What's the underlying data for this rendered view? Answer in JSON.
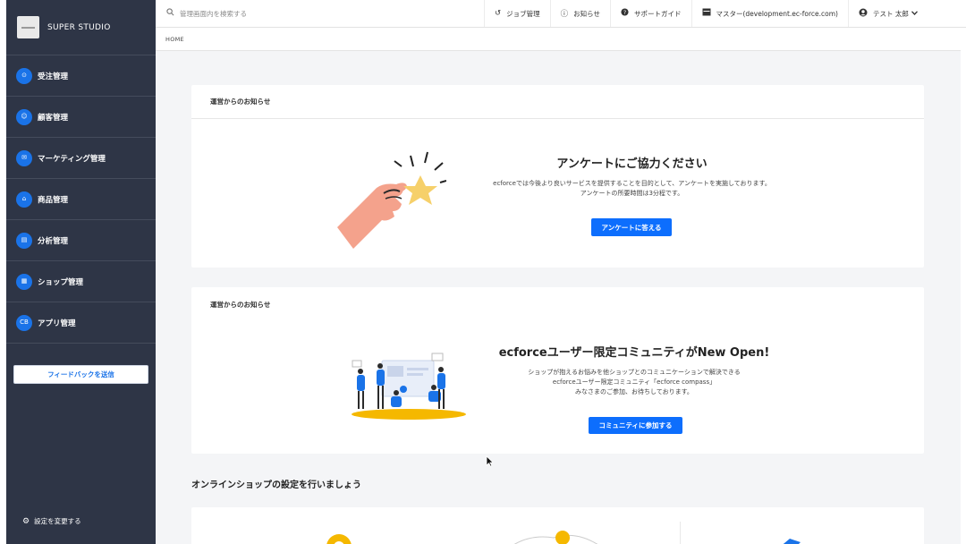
{
  "brand": {
    "name": "SUPER STUDIO"
  },
  "sidebar": {
    "items": [
      {
        "label": "受注管理",
        "icon": "cart-icon",
        "glyph": "⊙"
      },
      {
        "label": "顧客管理",
        "icon": "user-icon",
        "glyph": "☺"
      },
      {
        "label": "マーケティング管理",
        "icon": "mail-icon",
        "glyph": "✉"
      },
      {
        "label": "商品管理",
        "icon": "bag-icon",
        "glyph": "⌂"
      },
      {
        "label": "分析管理",
        "icon": "chart-icon",
        "glyph": "▤"
      },
      {
        "label": "ショップ管理",
        "icon": "store-icon",
        "glyph": "▦"
      },
      {
        "label": "アプリ管理",
        "icon": "app-icon",
        "glyph": "CB"
      }
    ],
    "feedback_label": "フィードバックを送信",
    "settings_label": "設定を変更する"
  },
  "header": {
    "search_placeholder": "管理画面内を検索する",
    "job_label": "ジョブ管理",
    "notice_label": "お知らせ",
    "support_label": "サポートガイド",
    "master_label": "マスター(development.ec-force.com)",
    "user_label": "テスト 太郎"
  },
  "breadcrumb": "HOME",
  "survey_card": {
    "header": "運営からのお知らせ",
    "title": "アンケートにご協力ください",
    "desc_line1": "ecforceでは今後より良いサービスを提供することを目的として、アンケートを実施しております。",
    "desc_line2": "アンケートの所要時間は3分程です。",
    "button": "アンケートに答える"
  },
  "community_card": {
    "header": "運営からのお知らせ",
    "title": "ecforceユーザー限定コミュニティがNew Open!",
    "desc_line1": "ショップが抱えるお悩みを他ショップとのコミュニケーションで解決できる",
    "desc_line2": "ecforceユーザー限定コミュニティ「ecforce compass」",
    "desc_line3": "みなさまのご参加、お待ちしております。",
    "button": "コミュニティに参加する"
  },
  "setup_section": {
    "title": "オンラインショップの設定を行いましょう"
  },
  "colors": {
    "sidebar_bg": "#2e3546",
    "accent": "#0d6efd",
    "main_bg": "#f4f5f7"
  }
}
